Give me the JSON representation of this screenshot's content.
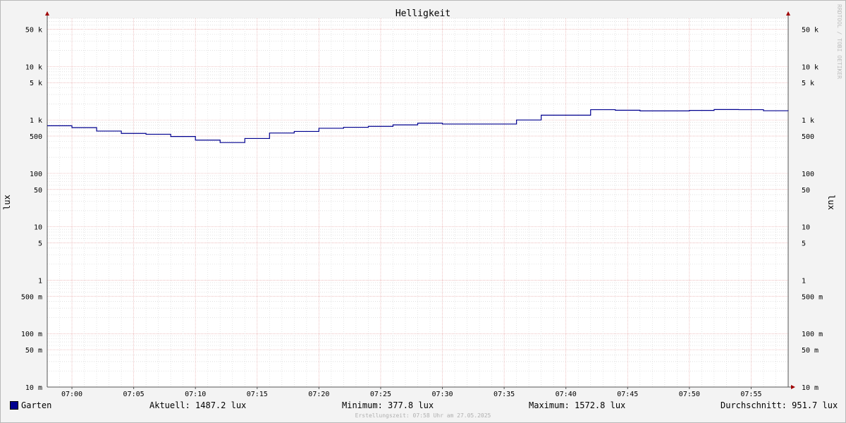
{
  "chart_data": {
    "type": "line",
    "title": "Helligkeit",
    "ylabel": "lux",
    "y_scale": "log",
    "ylim": [
      0.01,
      80000
    ],
    "y_ticks": [
      {
        "value": 50000,
        "label": "50 k"
      },
      {
        "value": 10000,
        "label": "10 k"
      },
      {
        "value": 5000,
        "label": "5 k"
      },
      {
        "value": 1000,
        "label": "1 k"
      },
      {
        "value": 500,
        "label": "500"
      },
      {
        "value": 100,
        "label": "100"
      },
      {
        "value": 50,
        "label": "50"
      },
      {
        "value": 10,
        "label": "10"
      },
      {
        "value": 5,
        "label": "5"
      },
      {
        "value": 1,
        "label": "1"
      },
      {
        "value": 0.5,
        "label": "500 m"
      },
      {
        "value": 0.1,
        "label": "100 m"
      },
      {
        "value": 0.05,
        "label": "50 m"
      },
      {
        "value": 0.01,
        "label": "10 m"
      }
    ],
    "x_ticks": [
      "07:00",
      "07:05",
      "07:10",
      "07:15",
      "07:20",
      "07:25",
      "07:30",
      "07:35",
      "07:40",
      "07:45",
      "07:50",
      "07:55"
    ],
    "xlim": [
      "06:58",
      "07:58"
    ],
    "grid": true,
    "series": [
      {
        "name": "Garten",
        "color": "#00008f",
        "step": "post",
        "x": [
          "06:58",
          "07:00",
          "07:02",
          "07:04",
          "07:06",
          "07:08",
          "07:10",
          "07:12",
          "07:14",
          "07:16",
          "07:18",
          "07:20",
          "07:22",
          "07:24",
          "07:26",
          "07:28",
          "07:30",
          "07:32",
          "07:34",
          "07:36",
          "07:38",
          "07:40",
          "07:42",
          "07:44",
          "07:46",
          "07:48",
          "07:50",
          "07:52",
          "07:54",
          "07:56",
          "07:58"
        ],
        "values": [
          780,
          720,
          620,
          560,
          540,
          490,
          420,
          378,
          450,
          570,
          610,
          700,
          730,
          760,
          810,
          870,
          840,
          840,
          840,
          1000,
          1230,
          1230,
          1560,
          1520,
          1480,
          1480,
          1510,
          1570,
          1560,
          1490,
          1487.2
        ]
      }
    ]
  },
  "legend": {
    "label": "Garten",
    "color": "#00008f"
  },
  "stats": {
    "current": "Aktuell: 1487.2 lux",
    "minimum": "Minimum: 377.8 lux",
    "maximum": "Maximum: 1572.8 lux",
    "average": "Durchschnitt: 951.7 lux"
  },
  "footer": "Erstellungszeit: 07:58 Uhr am 27.05.2025",
  "watermark": "RRDTOOL / TOBI OETIKER"
}
